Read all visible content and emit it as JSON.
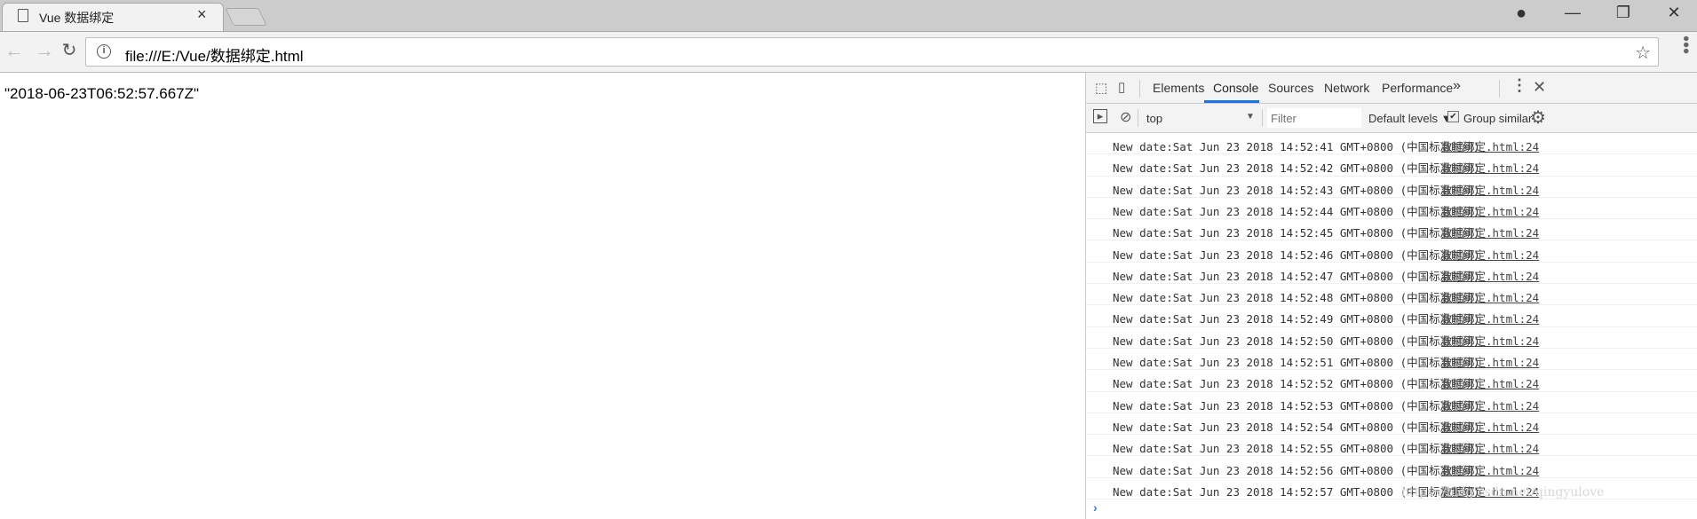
{
  "browser": {
    "tab_title": "Vue 数据绑定",
    "url": "file:///E:/Vue/数据绑定.html",
    "icons": {
      "tab": "page-icon",
      "close": "close-icon",
      "profile": "profile-icon",
      "minimize": "minimize-icon",
      "maximize": "restore-icon",
      "window_close": "close-icon",
      "back": "arrow-left-icon",
      "forward": "arrow-right-icon",
      "reload": "reload-icon",
      "info": "info-icon",
      "star": "star-icon",
      "menu": "kebab-menu-icon"
    }
  },
  "page": {
    "text": "\"2018-06-23T06:52:57.667Z\""
  },
  "devtools": {
    "tabs": [
      {
        "label": "Elements"
      },
      {
        "label": "Console",
        "active": true
      },
      {
        "label": "Sources"
      },
      {
        "label": "Network"
      },
      {
        "label": "Performance"
      }
    ],
    "more": "»",
    "context": "top",
    "filter_placeholder": "Filter",
    "levels": "Default levels ▼",
    "group_similar": "Group similar",
    "group_similar_checked": true,
    "accent": "#1a73e8",
    "logs": [
      {
        "msg": "New date:Sat Jun 23 2018 14:52:41 GMT+0800 (中国标准时间)",
        "src": "数据绑定.html:24"
      },
      {
        "msg": "New date:Sat Jun 23 2018 14:52:42 GMT+0800 (中国标准时间)",
        "src": "数据绑定.html:24"
      },
      {
        "msg": "New date:Sat Jun 23 2018 14:52:43 GMT+0800 (中国标准时间)",
        "src": "数据绑定.html:24"
      },
      {
        "msg": "New date:Sat Jun 23 2018 14:52:44 GMT+0800 (中国标准时间)",
        "src": "数据绑定.html:24"
      },
      {
        "msg": "New date:Sat Jun 23 2018 14:52:45 GMT+0800 (中国标准时间)",
        "src": "数据绑定.html:24"
      },
      {
        "msg": "New date:Sat Jun 23 2018 14:52:46 GMT+0800 (中国标准时间)",
        "src": "数据绑定.html:24"
      },
      {
        "msg": "New date:Sat Jun 23 2018 14:52:47 GMT+0800 (中国标准时间)",
        "src": "数据绑定.html:24"
      },
      {
        "msg": "New date:Sat Jun 23 2018 14:52:48 GMT+0800 (中国标准时间)",
        "src": "数据绑定.html:24"
      },
      {
        "msg": "New date:Sat Jun 23 2018 14:52:49 GMT+0800 (中国标准时间)",
        "src": "数据绑定.html:24"
      },
      {
        "msg": "New date:Sat Jun 23 2018 14:52:50 GMT+0800 (中国标准时间)",
        "src": "数据绑定.html:24"
      },
      {
        "msg": "New date:Sat Jun 23 2018 14:52:51 GMT+0800 (中国标准时间)",
        "src": "数据绑定.html:24"
      },
      {
        "msg": "New date:Sat Jun 23 2018 14:52:52 GMT+0800 (中国标准时间)",
        "src": "数据绑定.html:24"
      },
      {
        "msg": "New date:Sat Jun 23 2018 14:52:53 GMT+0800 (中国标准时间)",
        "src": "数据绑定.html:24"
      },
      {
        "msg": "New date:Sat Jun 23 2018 14:52:54 GMT+0800 (中国标准时间)",
        "src": "数据绑定.html:24"
      },
      {
        "msg": "New date:Sat Jun 23 2018 14:52:55 GMT+0800 (中国标准时间)",
        "src": "数据绑定.html:24"
      },
      {
        "msg": "New date:Sat Jun 23 2018 14:52:56 GMT+0800 (中国标准时间)",
        "src": "数据绑定.html:24"
      },
      {
        "msg": "New date:Sat Jun 23 2018 14:52:57 GMT+0800 (中国标准时间)",
        "src": "数据绑定.html:24"
      }
    ],
    "prompt": "›"
  },
  "watermark": "https://blog.csdn.net/qingyulove"
}
